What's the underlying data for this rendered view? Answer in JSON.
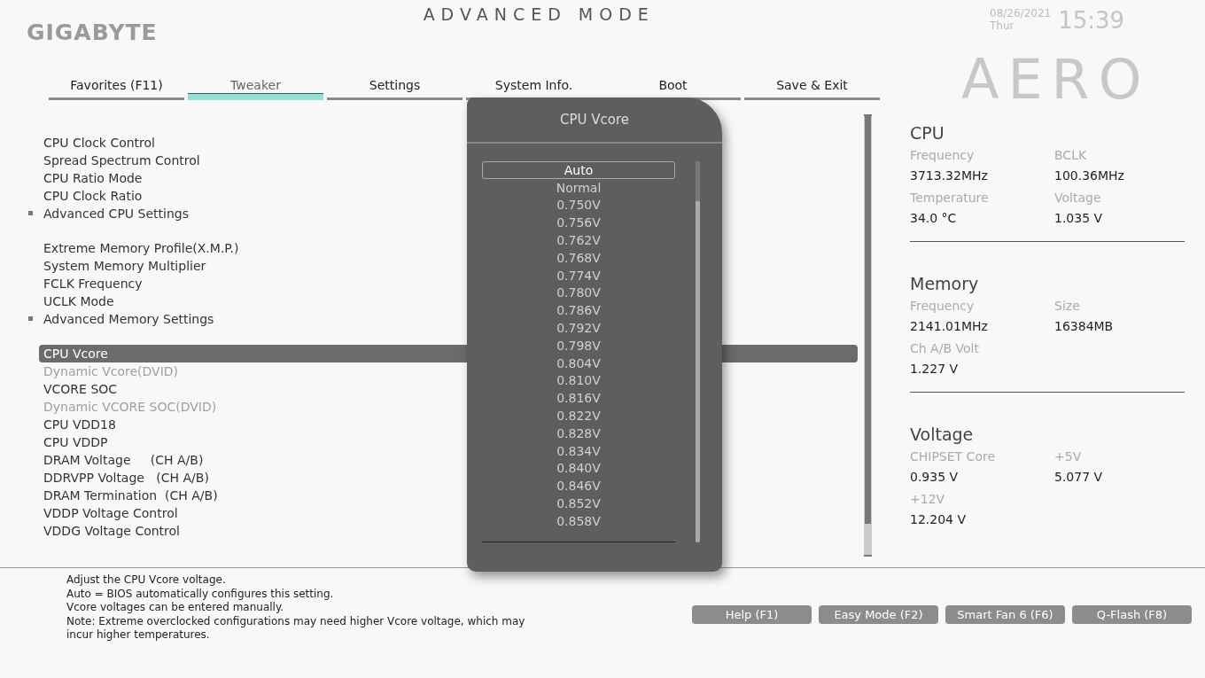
{
  "logo": "GIGABYTE",
  "title": "ADVANCED MODE",
  "date": "08/26/2021",
  "day": "Thur",
  "time": "15:39",
  "brand_mark": "AERO",
  "tabs": [
    {
      "label": "Favorites (F11)",
      "selected": false
    },
    {
      "label": "Tweaker",
      "selected": true
    },
    {
      "label": "Settings",
      "selected": false
    },
    {
      "label": "System Info.",
      "selected": false
    },
    {
      "label": "Boot",
      "selected": false
    },
    {
      "label": "Save & Exit",
      "selected": false
    }
  ],
  "settings_groups": [
    [
      {
        "label": "CPU Clock Control",
        "kind": "item",
        "selected": false,
        "disabled": false
      },
      {
        "label": "Spread Spectrum Control",
        "kind": "item",
        "selected": false,
        "disabled": false
      },
      {
        "label": "CPU Ratio Mode",
        "kind": "item",
        "selected": false,
        "disabled": false
      },
      {
        "label": "CPU Clock Ratio",
        "kind": "item",
        "selected": false,
        "disabled": false
      },
      {
        "label": "Advanced CPU Settings",
        "kind": "submenu",
        "selected": false,
        "disabled": false
      }
    ],
    [
      {
        "label": "Extreme Memory Profile(X.M.P.)",
        "kind": "item",
        "selected": false,
        "disabled": false
      },
      {
        "label": "System Memory Multiplier",
        "kind": "item",
        "selected": false,
        "disabled": false
      },
      {
        "label": "FCLK Frequency",
        "kind": "item",
        "selected": false,
        "disabled": false
      },
      {
        "label": "UCLK Mode",
        "kind": "item",
        "selected": false,
        "disabled": false
      },
      {
        "label": "Advanced Memory Settings",
        "kind": "submenu",
        "selected": false,
        "disabled": false
      }
    ],
    [
      {
        "label": "CPU Vcore",
        "kind": "item",
        "selected": true,
        "disabled": false
      },
      {
        "label": "Dynamic Vcore(DVID)",
        "kind": "item",
        "selected": false,
        "disabled": true
      },
      {
        "label": "VCORE SOC",
        "kind": "item",
        "selected": false,
        "disabled": false
      },
      {
        "label": "Dynamic VCORE SOC(DVID)",
        "kind": "item",
        "selected": false,
        "disabled": true
      },
      {
        "label": "CPU VDD18",
        "kind": "item",
        "selected": false,
        "disabled": false
      },
      {
        "label": "CPU VDDP",
        "kind": "item",
        "selected": false,
        "disabled": false
      },
      {
        "label": "DRAM Voltage     (CH A/B)",
        "kind": "item",
        "selected": false,
        "disabled": false
      },
      {
        "label": "DDRVPP Voltage   (CH A/B)",
        "kind": "item",
        "selected": false,
        "disabled": false
      },
      {
        "label": "DRAM Termination  (CH A/B)",
        "kind": "item",
        "selected": false,
        "disabled": false
      },
      {
        "label": "VDDP Voltage Control",
        "kind": "item",
        "selected": false,
        "disabled": false
      },
      {
        "label": "VDDG Voltage Control",
        "kind": "item",
        "selected": false,
        "disabled": false
      }
    ]
  ],
  "popup": {
    "title": "CPU Vcore",
    "options": [
      {
        "label": "Auto",
        "selected": true
      },
      {
        "label": "Normal",
        "selected": false
      },
      {
        "label": "0.750V",
        "selected": false
      },
      {
        "label": "0.756V",
        "selected": false
      },
      {
        "label": "0.762V",
        "selected": false
      },
      {
        "label": "0.768V",
        "selected": false
      },
      {
        "label": "0.774V",
        "selected": false
      },
      {
        "label": "0.780V",
        "selected": false
      },
      {
        "label": "0.786V",
        "selected": false
      },
      {
        "label": "0.792V",
        "selected": false
      },
      {
        "label": "0.798V",
        "selected": false
      },
      {
        "label": "0.804V",
        "selected": false
      },
      {
        "label": "0.810V",
        "selected": false
      },
      {
        "label": "0.816V",
        "selected": false
      },
      {
        "label": "0.822V",
        "selected": false
      },
      {
        "label": "0.828V",
        "selected": false
      },
      {
        "label": "0.834V",
        "selected": false
      },
      {
        "label": "0.840V",
        "selected": false
      },
      {
        "label": "0.846V",
        "selected": false
      },
      {
        "label": "0.852V",
        "selected": false
      },
      {
        "label": "0.858V",
        "selected": false
      }
    ]
  },
  "monitor": [
    {
      "title": "CPU",
      "fields": [
        {
          "label": "Frequency",
          "value": "3713.32MHz"
        },
        {
          "label": "BCLK",
          "value": "100.36MHz"
        },
        {
          "label": "Temperature",
          "value": "34.0 °C"
        },
        {
          "label": "Voltage",
          "value": "1.035 V"
        }
      ]
    },
    {
      "title": "Memory",
      "fields": [
        {
          "label": "Frequency",
          "value": "2141.01MHz"
        },
        {
          "label": "Size",
          "value": "16384MB"
        },
        {
          "label": "Ch A/B Volt",
          "value": "1.227 V"
        }
      ]
    },
    {
      "title": "Voltage",
      "fields": [
        {
          "label": "CHIPSET Core",
          "value": "0.935 V"
        },
        {
          "label": "+5V",
          "value": "5.077 V"
        },
        {
          "label": "+12V",
          "value": "12.204 V"
        }
      ]
    }
  ],
  "help": [
    "Adjust the CPU Vcore voltage.",
    "Auto = BIOS automatically configures this setting.",
    "Vcore voltages can be entered manually.",
    "Note: Extreme overclocked configurations may need higher Vcore voltage, which may",
    "incur higher temperatures."
  ],
  "buttons": [
    "Help (F1)",
    "Easy Mode (F2)",
    "Smart Fan 6 (F6)",
    "Q-Flash (F8)"
  ]
}
